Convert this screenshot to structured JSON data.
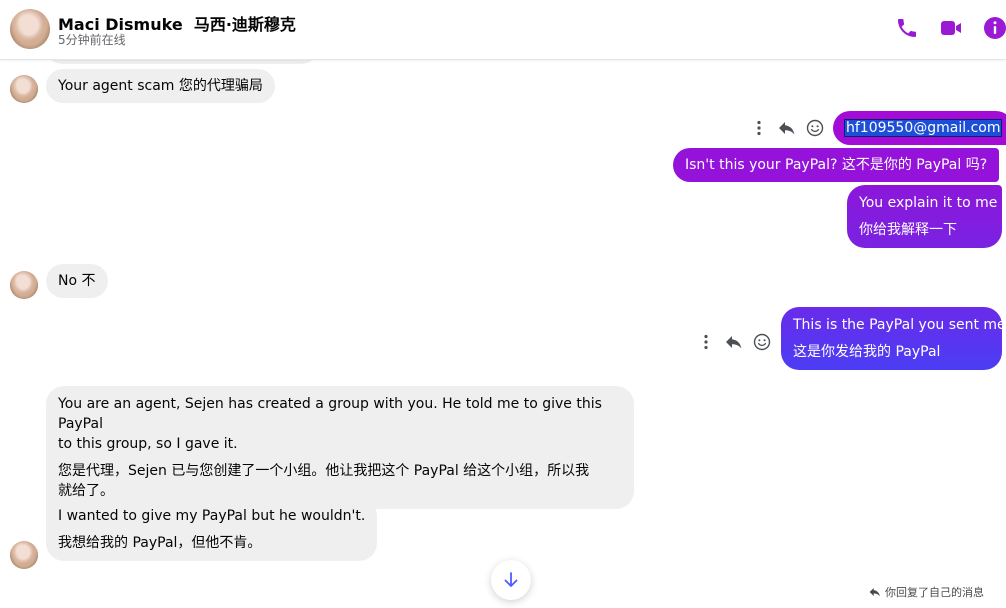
{
  "header": {
    "name": "Maci Dismuke",
    "name_cn": "马西·迪斯穆克",
    "status": "5分钟前在线",
    "icons": [
      "phone-icon",
      "video-camera-icon",
      "info-icon"
    ],
    "accent_color": "#9a19d4"
  },
  "messages": [
    {
      "dir": "in",
      "text": "Your agent scam  您的代理骗局"
    },
    {
      "dir": "out",
      "email": "hf109550@gmail.com"
    },
    {
      "dir": "out",
      "text": "Isn't this your PayPal?  这不是你的 PayPal 吗?"
    },
    {
      "dir": "out",
      "line1": "You explain it to me",
      "line2": "你给我解释一下"
    },
    {
      "dir": "in",
      "text": "No  不"
    },
    {
      "dir": "out",
      "line1": "This is the PayPal you sent me",
      "line2": "这是你发给我的 PayPal"
    },
    {
      "dir": "in",
      "line1": "You are an agent, Sejen has created a group with you. He told me to give this PayPal",
      "line1b": "to this group, so I gave it.",
      "line2": "您是代理，Sejen 已与您创建了一个小组。他让我把这个 PayPal 给这个小组，所以我",
      "line2b": "就给了。"
    },
    {
      "dir": "in",
      "line1": "I wanted to give my PayPal but he wouldn't.",
      "line2": "我想给我的 PayPal，但他不肯。"
    }
  ],
  "footer": {
    "reply_note": "你回复了自己的消息"
  },
  "colors": {
    "outgoing_top": "#a40ad6",
    "outgoing_bottom": "#4f3bf5",
    "incoming": "#efefef"
  }
}
